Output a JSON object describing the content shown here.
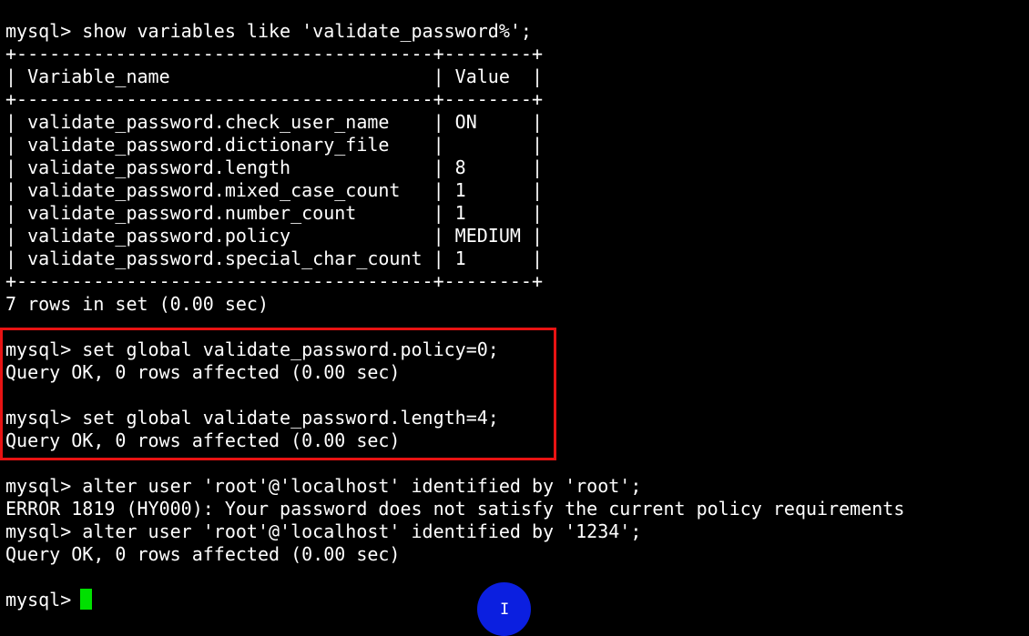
{
  "terminal": {
    "lines": [
      "mysql> show variables like 'validate_password%';",
      "+--------------------------------------+--------+",
      "| Variable_name                        | Value  |",
      "+--------------------------------------+--------+",
      "| validate_password.check_user_name    | ON     |",
      "| validate_password.dictionary_file    |        |",
      "| validate_password.length             | 8      |",
      "| validate_password.mixed_case_count   | 1      |",
      "| validate_password.number_count       | 1      |",
      "| validate_password.policy             | MEDIUM |",
      "| validate_password.special_char_count | 1      |",
      "+--------------------------------------+--------+",
      "7 rows in set (0.00 sec)",
      "",
      "mysql> set global validate_password.policy=0;",
      "Query OK, 0 rows affected (0.00 sec)",
      "",
      "mysql> set global validate_password.length=4;",
      "Query OK, 0 rows affected (0.00 sec)",
      "",
      "mysql> alter user 'root'@'localhost' identified by 'root';",
      "ERROR 1819 (HY000): Your password does not satisfy the current policy requirements",
      "mysql> alter user 'root'@'localhost' identified by '1234';",
      "Query OK, 0 rows affected (0.00 sec)",
      "",
      "mysql> "
    ]
  },
  "colors": {
    "background": "#000000",
    "text": "#ffffff",
    "highlight_border": "#e81313",
    "cursor": "#00e000",
    "click_indicator": "#0b1fe0"
  },
  "icons": {
    "mouse_pointer": "I"
  }
}
